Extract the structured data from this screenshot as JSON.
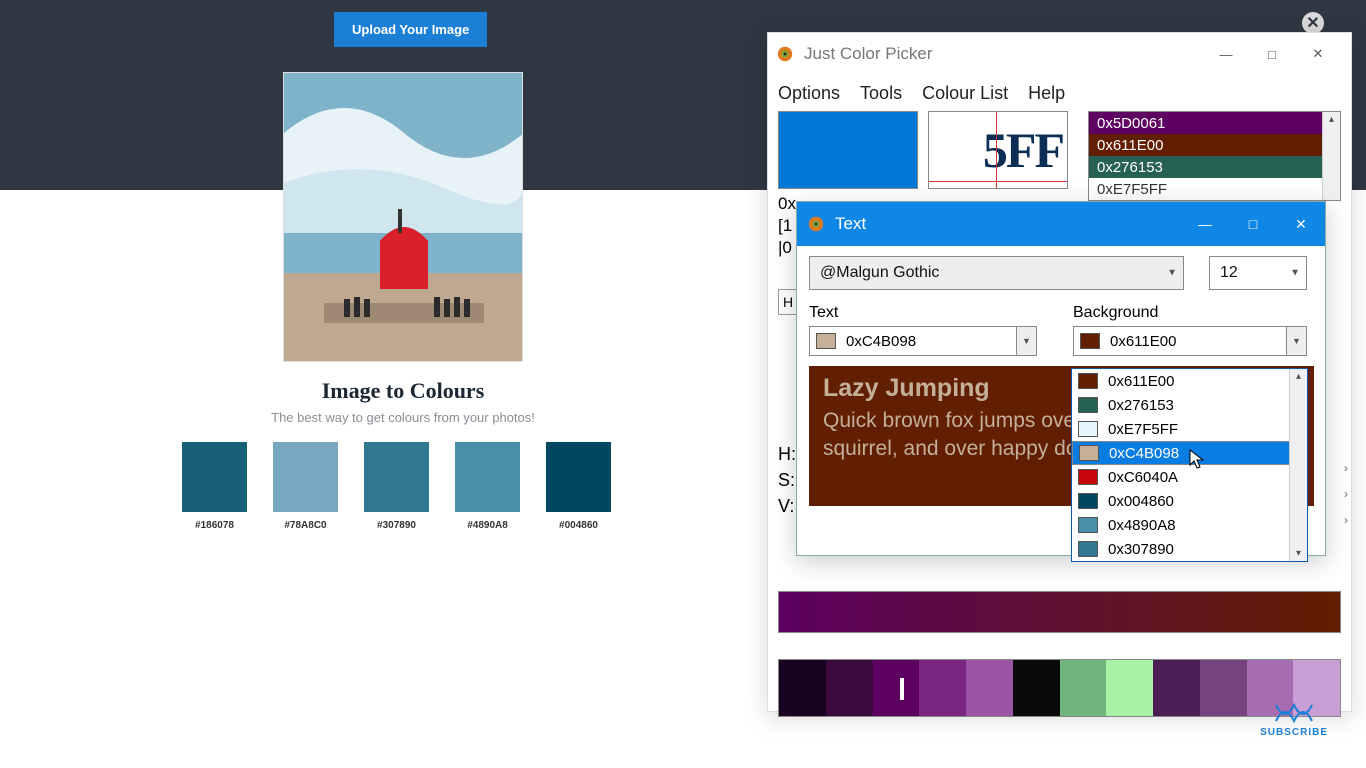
{
  "web": {
    "upload": "Upload Your Image",
    "hero_title": "Image to Colours",
    "hero_sub": "The best way to get colours from your photos!",
    "palette": [
      {
        "hex": "#186078"
      },
      {
        "hex": "#78A8C0"
      },
      {
        "hex": "#307890"
      },
      {
        "hex": "#4890A8"
      },
      {
        "hex": "#004860"
      }
    ]
  },
  "jcp": {
    "title": "Just Color Picker",
    "menu": [
      "Options",
      "Tools",
      "Colour List",
      "Help"
    ],
    "current_swatch": "#0079d8",
    "zoom_fragment": "5FF",
    "code_lines": [
      "0x",
      "[1",
      "|0"
    ],
    "h_field": "H",
    "hsv": [
      "H:",
      "S:",
      "V:"
    ],
    "colour_list": [
      {
        "hex": "#5D0061",
        "label": "0x5D0061"
      },
      {
        "hex": "#611E00",
        "label": "0x611E00"
      },
      {
        "hex": "#276153",
        "label": "0x276153"
      }
    ],
    "colour_list_partial": "0xE7F5FF",
    "shades": [
      "#1a0320",
      "#3b0b3f",
      "#5d0061",
      "#7b2682",
      "#9b53a3",
      "#0a0a0a",
      "#6fb47a",
      "#a8f2a8",
      "#4d1e55",
      "#76427f",
      "#a56cb0",
      "#c99ed4"
    ]
  },
  "txt": {
    "title": "Text",
    "font": "@Malgun Gothic",
    "size": "12",
    "label_text": "Text",
    "label_bg": "Background",
    "text_color": {
      "hex": "#C4B098",
      "label": "0xC4B098"
    },
    "bg_color": {
      "hex": "#611E00",
      "label": "0x611E00"
    },
    "preview_heading": "Lazy Jumping",
    "preview_body": "Quick brown fox jumps over good cow, fox, squirrel, and over happy dogs. Now is"
  },
  "dropdown": [
    {
      "hex": "#611E00",
      "label": "0x611E00"
    },
    {
      "hex": "#276153",
      "label": "0x276153"
    },
    {
      "hex": "#E7F5FF",
      "label": "0xE7F5FF"
    },
    {
      "hex": "#C4B098",
      "label": "0xC4B098",
      "selected": true
    },
    {
      "hex": "#C6040A",
      "label": "0xC6040A"
    },
    {
      "hex": "#004860",
      "label": "0x004860"
    },
    {
      "hex": "#4890A8",
      "label": "0x4890A8"
    },
    {
      "hex": "#307890",
      "label": "0x307890"
    }
  ],
  "subscribe": "SUBSCRIBE"
}
